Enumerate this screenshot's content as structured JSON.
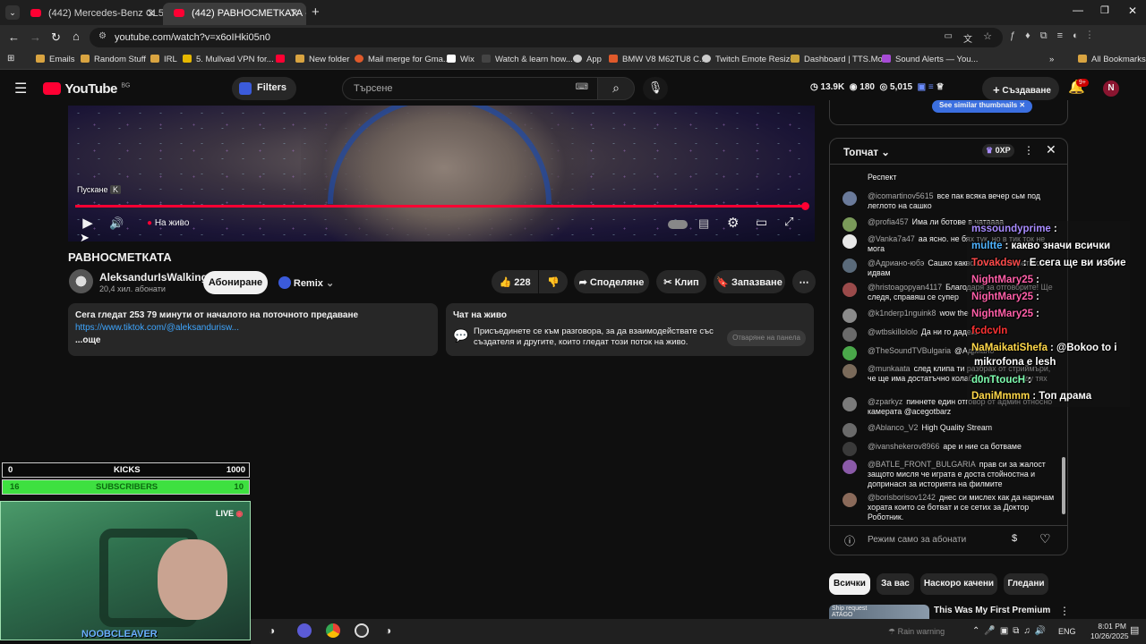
{
  "browser": {
    "tabs": [
      {
        "title": "(442) Mercedes-Benz CL500 4m"
      },
      {
        "title": "(442) РАВНОСМЕТКАТА - Y"
      }
    ],
    "url": "youtube.com/watch?v=x6oIHki05n0",
    "bookmarks": [
      "Emails",
      "Random Stuff",
      "IRL",
      "5. Mullvad VPN for...",
      "New folder",
      "Mail merge for Gma...",
      "Wix",
      "Watch & learn how...",
      "App",
      "BMW V8 M62TU8 C...",
      "Twitch Emote Resizer",
      "Dashboard | TTS.Mo...",
      "Sound Alerts — You..."
    ],
    "all_bookmarks": "All Bookmarks"
  },
  "yt_header": {
    "logo": "YouTube",
    "region": "BG",
    "filters": "Filters",
    "search_placeholder": "Търсене",
    "stats": {
      "views": "13.9K",
      "viewers": "180",
      "likes": "5,015"
    },
    "create": "Създаване",
    "notif_badge": "9+"
  },
  "player": {
    "tooltip": "Пускане",
    "tooltip_key": "K",
    "live_label": "На живо",
    "progress": 1.0
  },
  "video": {
    "title": "РАВНОСМЕТКАТА",
    "channel": "AleksandurIsWalking",
    "subs": "20,4 хил. абонати",
    "subscribe": "Абониране",
    "remix": "Remix",
    "likes": "228",
    "share": "Споделяне",
    "clip": "Клип",
    "save": "Запазване"
  },
  "description": {
    "line1": "Сега гледат 253  79 минути от началото на поточното предаване",
    "link": "https://www.tiktok.com/@aleksandurisw...",
    "more": "...още"
  },
  "live_chat_card": {
    "title": "Чат на живо",
    "text": "Присъединете се към разговора, за да взаимодействате със създателя и другите, които гледат този поток на живо.",
    "button": "Отваряне на панела"
  },
  "overlay_widget": {
    "kicks_min": "0",
    "kicks_label": "KICKS",
    "kicks_max": "1000",
    "subs_min": "16",
    "subs_label": "SUBSCRIBERS",
    "subs_max": "10",
    "live": "LIVE",
    "name": "NOOBCLEAVER"
  },
  "chat": {
    "header": "Топчат",
    "points": "0XP",
    "top_partial": "Респект",
    "messages": [
      {
        "author": "@icomartinov5615",
        "text": "все пак всяка вечер сьм под леглото на сашко"
      },
      {
        "author": "@profia457",
        "text": "Има ли ботове в чатаааа"
      },
      {
        "author": "@Vanka7a47",
        "text": "аа ясно. не бях тук. но в тик ток не могa"
      },
      {
        "author": "@Адриано-юбэ",
        "text": "Сашко какво значи камерата сега идвам"
      },
      {
        "author": "@hristoagopyan4117",
        "text": "Благодаря за отговорите! Ще следя, справяш се супер"
      },
      {
        "author": "@k1nderp1nguink8",
        "text": "wow the"
      },
      {
        "author": "@wtbskillololo",
        "text": "Да ни го дадеш"
      },
      {
        "author": "@TheSoundTVBulgaria",
        "text": "@Адриано"
      },
      {
        "author": "@munkaata",
        "text": "след клипа ти разбрах от стриймъри, че ще има достатъчно колаборации измежду тях"
      },
      {
        "author": "@zparkyz",
        "text": "пиннете един отговор от админ относно камерата @acegotbarz"
      },
      {
        "author": "@Ablanco_V2",
        "text": "High Quality Stream"
      },
      {
        "author": "@ivanshekerov8966",
        "text": "аре и ние са ботваме"
      },
      {
        "author": "@BATLE_FRONT_BULGARIA",
        "text": "прав си за жалост защото мисля че играта е доста стойностна и допринася за историята на филмите"
      },
      {
        "author": "@borisborisov1242",
        "text": "днес си мислех как да наричам хората които се ботват и се сетих за Доктор Роботник."
      }
    ],
    "input_placeholder": "Режим само за абонати"
  },
  "overlay_chat": [
    {
      "name": "mssoundyprime",
      "text": ":",
      "color": "#a98cff"
    },
    {
      "name": "multte",
      "text": ": какво значи всички",
      "color": "#4fb3ff"
    },
    {
      "name": "Tovakdsw",
      "text": ": Е сега ще ви избие",
      "color": "#ff4a4a"
    },
    {
      "name": "NightMary25",
      "text": ":",
      "color": "#ff5fa8"
    },
    {
      "name": "NightMary25",
      "text": ":",
      "color": "#ff5fa8"
    },
    {
      "name": "NightMary25",
      "text": ":",
      "color": "#ff5fa8"
    },
    {
      "name": "fcdcvln",
      "text": "",
      "color": "#ff3333"
    },
    {
      "name": "NaMaikatiShefa",
      "text": ": @Bokoo to i",
      "color": "#ffd84a"
    },
    {
      "name": "",
      "text": "mikrofona e lesh",
      "color": "#ffffff"
    },
    {
      "name": "d0nTtoucH",
      "text": ":",
      "color": "#7fffb0"
    },
    {
      "name": "DaniMmmm",
      "text": ": Топ драма",
      "color": "#ffd84a"
    }
  ],
  "filter_chips": [
    "Всички",
    "За вас",
    "Наскоро качени",
    "Гледани"
  ],
  "rec": {
    "title": "This Was My First Premium",
    "thumb_text": "Ship request",
    "thumb_sub": "ATAGO"
  },
  "thumbnail_button": "See similar thumbnails",
  "taskbar": {
    "weather": "Rain warning",
    "lang": "ENG",
    "time": "8:01 PM",
    "date": "10/26/2025"
  }
}
